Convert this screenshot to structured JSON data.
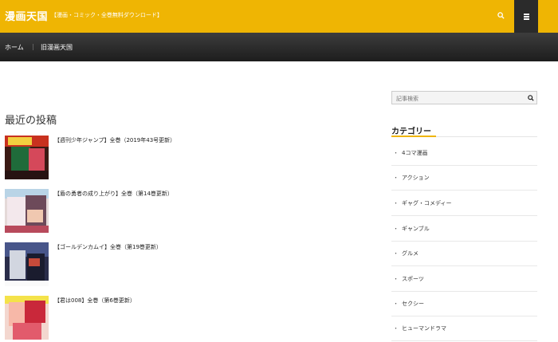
{
  "header": {
    "site_title": "漫画天国",
    "tagline": "【漫画・コミック・全巻無料ダウンロード】"
  },
  "breadcrumb": {
    "home": "ホーム",
    "separator": "|",
    "current": "旧漫画天国"
  },
  "main": {
    "section_title": "最近の投稿",
    "posts": [
      {
        "title": "【週刊少年ジャンプ】全巻（2019年43号更新）"
      },
      {
        "title": "【盾の勇者の成り上がり】全巻（第14巻更新）"
      },
      {
        "title": "【ゴールデンカムイ】全巻（第19巻更新）"
      },
      {
        "title": "【君は008】全巻（第6巻更新）"
      }
    ]
  },
  "sidebar": {
    "search_placeholder": "記事検索",
    "category_title": "カテゴリー",
    "bullet": "・",
    "categories": [
      {
        "label": "4コマ漫画"
      },
      {
        "label": "アクション"
      },
      {
        "label": "ギャグ・コメディー"
      },
      {
        "label": "ギャンブル"
      },
      {
        "label": "グルメ"
      },
      {
        "label": "スポーツ"
      },
      {
        "label": "セクシー"
      },
      {
        "label": "ヒューマンドラマ"
      }
    ]
  },
  "colors": {
    "accent": "#efb503",
    "nav_dark": "#1d1d1d"
  },
  "icons": {
    "header_search": "search-icon",
    "menu": "hamburger-menu-icon",
    "sidebar_search": "search-icon"
  }
}
